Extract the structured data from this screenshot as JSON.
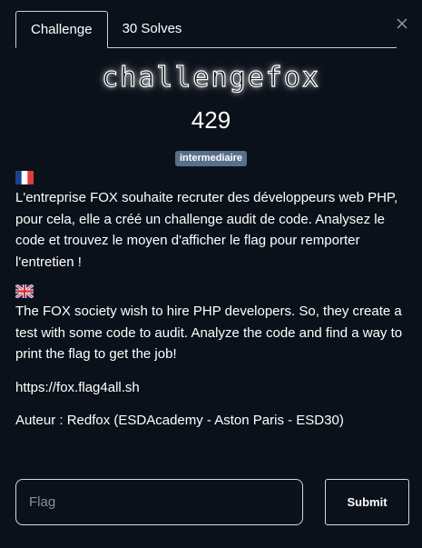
{
  "tabs": [
    {
      "label": "Challenge",
      "active": true
    },
    {
      "label": "30 Solves",
      "active": false
    }
  ],
  "challenge": {
    "name": "challengefox",
    "points": "429",
    "difficulty": "intermediaire"
  },
  "description": {
    "fr_flag_icon": "flag-france",
    "fr_text": "L'entreprise FOX souhaite recruter des développeurs web PHP, pour cela, elle a créé un challenge audit de code. Analysez le code et trouvez le moyen d'afficher le flag pour remporter l'entretien !",
    "en_flag_icon": "flag-uk",
    "en_text": "The FOX society wish to hire PHP developers. So, they create a test with some code to audit. Analyze the code and find a way to print the flag to get the job!",
    "url": "https://fox.flag4all.sh",
    "author": "Auteur : Redfox (ESDAcademy - Aston Paris - ESD30)"
  },
  "form": {
    "flag_placeholder": "Flag",
    "flag_value": "",
    "submit_label": "Submit"
  },
  "colors": {
    "background": "#0b111a",
    "badge": "#5a6f8c",
    "border": "#d0d0d0"
  }
}
